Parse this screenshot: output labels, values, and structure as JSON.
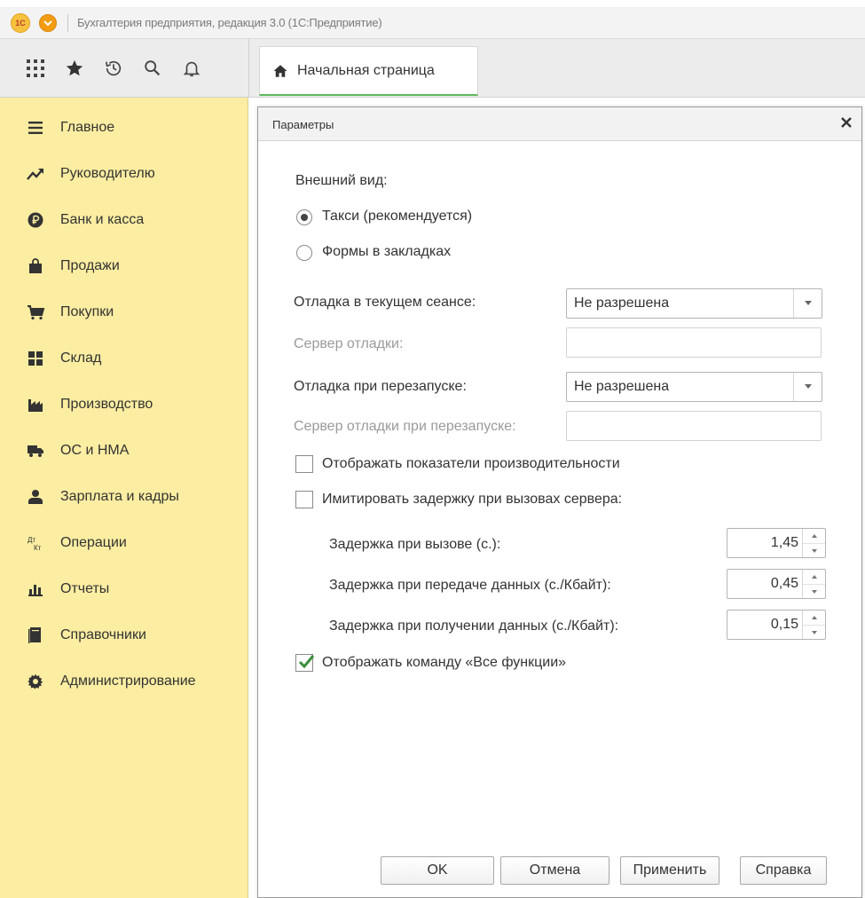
{
  "window": {
    "title": "Бухгалтерия предприятия, редакция 3.0  (1С:Предприятие)",
    "logo_text": "1С"
  },
  "toolbar": {
    "icons": [
      "apps-grid-icon",
      "star-icon",
      "history-icon",
      "search-icon",
      "bell-icon"
    ],
    "home_tab_label": "Начальная страница"
  },
  "sidebar": {
    "items": [
      {
        "label": "Главное",
        "icon": "menu-lines-icon"
      },
      {
        "label": "Руководителю",
        "icon": "trend-icon"
      },
      {
        "label": "Банк и касса",
        "icon": "ruble-icon"
      },
      {
        "label": "Продажи",
        "icon": "bag-icon"
      },
      {
        "label": "Покупки",
        "icon": "cart-icon"
      },
      {
        "label": "Склад",
        "icon": "warehouse-icon"
      },
      {
        "label": "Производство",
        "icon": "factory-icon"
      },
      {
        "label": "ОС и НМА",
        "icon": "truck-icon"
      },
      {
        "label": "Зарплата и кадры",
        "icon": "person-icon"
      },
      {
        "label": "Операции",
        "icon": "dt-kt-icon"
      },
      {
        "label": "Отчеты",
        "icon": "bar-chart-icon"
      },
      {
        "label": "Справочники",
        "icon": "books-icon"
      },
      {
        "label": "Администрирование",
        "icon": "gear-icon"
      }
    ]
  },
  "dialog": {
    "title": "Параметры",
    "appearance_label": "Внешний вид:",
    "radio_taxi": "Такси (рекомендуется)",
    "radio_tabs": "Формы в закладках",
    "debug_session_label": "Отладка в текущем сеансе:",
    "debug_session_value": "Не разрешена",
    "debug_server_label": "Сервер отладки:",
    "debug_restart_label": "Отладка при перезапуске:",
    "debug_restart_value": "Не разрешена",
    "debug_restart_server_label": "Сервер отладки при перезапуске:",
    "show_perf_label": "Отображать показатели производительности",
    "simulate_delay_label": "Имитировать задержку при вызовах сервера:",
    "delay_call_label": "Задержка при вызове (с.):",
    "delay_call_value": "1,45",
    "delay_send_label": "Задержка при передаче данных (с./Кбайт):",
    "delay_send_value": "0,45",
    "delay_recv_label": "Задержка при получении данных (с./Кбайт):",
    "delay_recv_value": "0,15",
    "all_functions_label": "Отображать команду «Все функции»",
    "ok_button": "OK",
    "cancel_button": "Отмена",
    "apply_button": "Применить",
    "help_button": "Справка"
  }
}
